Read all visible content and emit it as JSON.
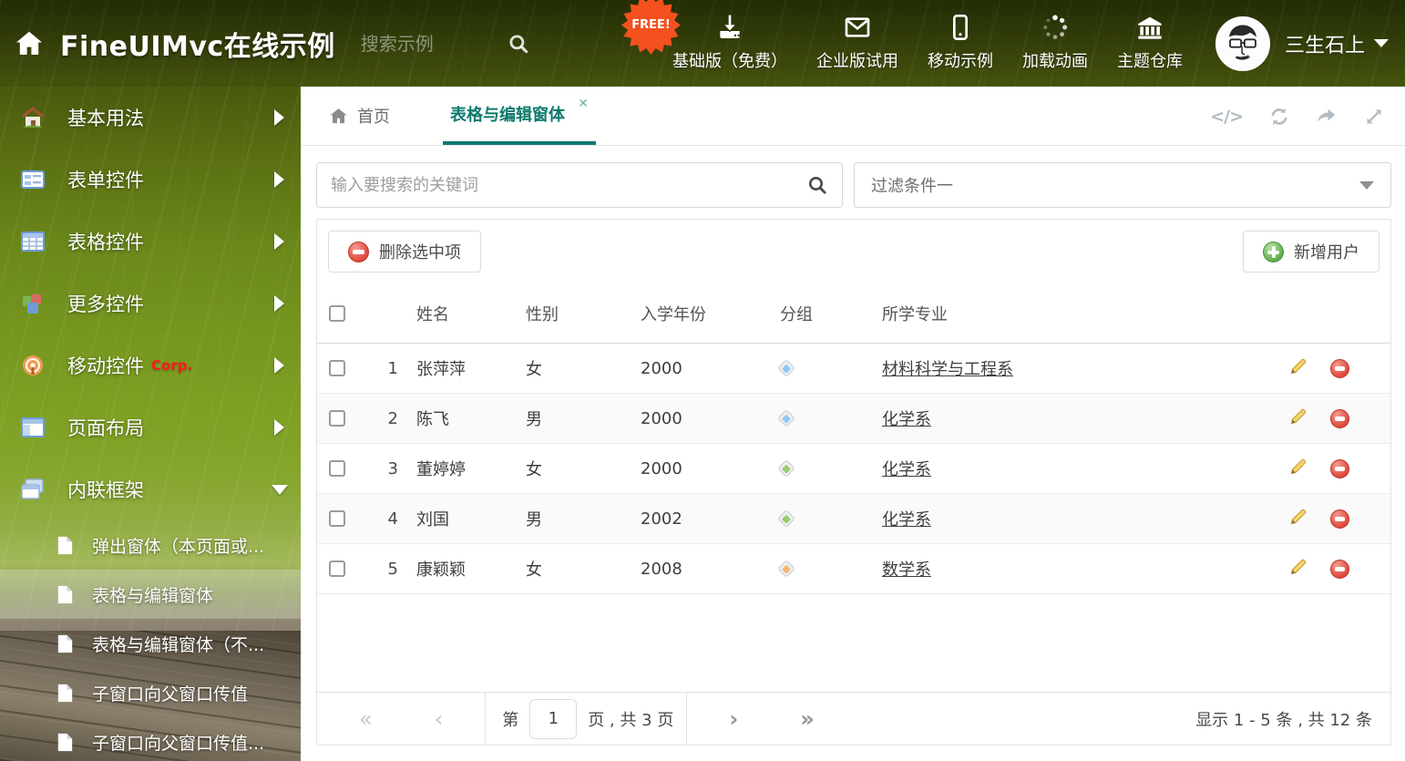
{
  "colors": {
    "accent": "#0e7a6e",
    "danger": "#e2574c",
    "success": "#67b355",
    "header_title": "#ffffff"
  },
  "header": {
    "title": "FineUIMvc在线示例",
    "search_placeholder": "搜索示例",
    "free_badge": "FREE!",
    "nav": [
      {
        "label": "基础版（免费）",
        "icon": "download-icon"
      },
      {
        "label": "企业版试用",
        "icon": "envelope-icon"
      },
      {
        "label": "移动示例",
        "icon": "mobile-icon"
      },
      {
        "label": "加载动画",
        "icon": "spinner-icon"
      },
      {
        "label": "主题仓库",
        "icon": "bank-icon"
      }
    ],
    "user_name": "三生石上"
  },
  "sidebar": {
    "items": [
      {
        "label": "基本用法",
        "icon": "house-icon"
      },
      {
        "label": "表单控件",
        "icon": "form-icon"
      },
      {
        "label": "表格控件",
        "icon": "grid-icon"
      },
      {
        "label": "更多控件",
        "icon": "cubes-icon"
      },
      {
        "label": "移动控件",
        "badge": "Corp.",
        "icon": "radar-icon"
      },
      {
        "label": "页面布局",
        "icon": "layout-icon"
      },
      {
        "label": "内联框架",
        "icon": "frames-icon"
      }
    ],
    "children": [
      {
        "label": "弹出窗体（本页面或..."
      },
      {
        "label": "表格与编辑窗体"
      },
      {
        "label": "表格与编辑窗体（不..."
      },
      {
        "label": "子窗口向父窗口传值"
      },
      {
        "label": "子窗口向父窗口传值..."
      }
    ]
  },
  "tabs": {
    "home": "首页",
    "active": "表格与编辑窗体",
    "close_glyph": "✕"
  },
  "icons": {
    "code_glyph": "</>"
  },
  "filters": {
    "search_placeholder": "输入要搜索的关键词",
    "filter_value": "过滤条件一"
  },
  "toolbar": {
    "delete_label": "删除选中项",
    "add_label": "新增用户"
  },
  "table": {
    "columns": {
      "name": "姓名",
      "gender": "性别",
      "year": "入学年份",
      "group": "分组",
      "major": "所学专业"
    },
    "rows": [
      {
        "index": "1",
        "name": "张萍萍",
        "gender": "女",
        "year": "2000",
        "tag_color": "#8ec7f2",
        "major": "材料科学与工程系"
      },
      {
        "index": "2",
        "name": "陈飞",
        "gender": "男",
        "year": "2000",
        "tag_color": "#8ec7f2",
        "major": "化学系"
      },
      {
        "index": "3",
        "name": "董婷婷",
        "gender": "女",
        "year": "2000",
        "tag_color": "#97cd6d",
        "major": "化学系"
      },
      {
        "index": "4",
        "name": "刘国",
        "gender": "男",
        "year": "2002",
        "tag_color": "#97cd6d",
        "major": "化学系"
      },
      {
        "index": "5",
        "name": "康颖颖",
        "gender": "女",
        "year": "2008",
        "tag_color": "#f7b66d",
        "major": "数学系"
      }
    ]
  },
  "pagination": {
    "first": "«",
    "prev": "‹",
    "next": "›",
    "last": "»",
    "label_prefix": "第",
    "page": "1",
    "label_suffix": "页 , 共 3 页",
    "summary": "显示 1 - 5 条 , 共 12 条"
  }
}
